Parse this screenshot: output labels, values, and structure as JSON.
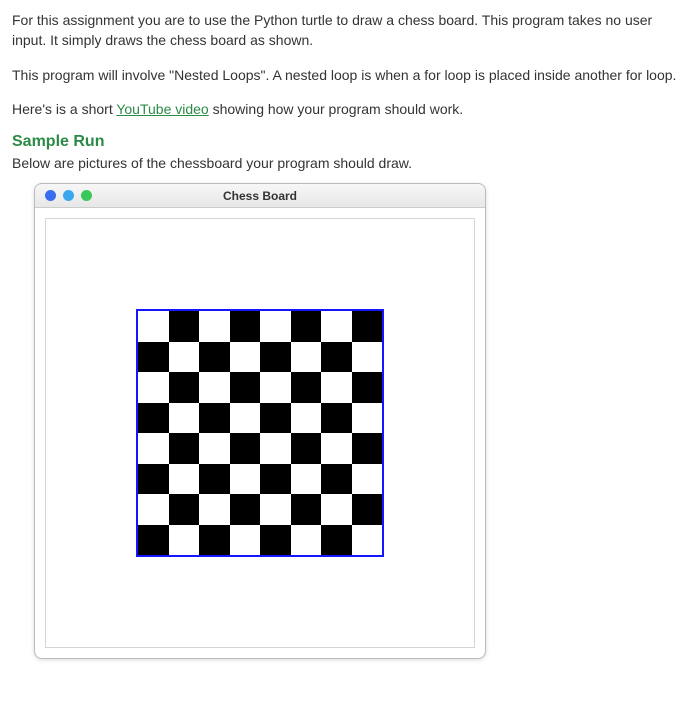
{
  "para1": "For this assignment you are to use the Python turtle to draw a chess board. This program takes no user input. It simply draws the chess board as shown.",
  "para2": "This program will involve \"Nested Loops\". A nested loop is when a for loop is placed inside another for loop.",
  "para3_prefix": "Here's is a short ",
  "para3_link": "YouTube video",
  "para3_suffix": " showing how your program should work.",
  "sample_heading": "Sample Run",
  "sample_sub": "Below are pictures of the chessboard your program should draw.",
  "window_title": "Chess Board",
  "board": {
    "rows": 8,
    "cols": 8,
    "border_color": "#1515ff"
  }
}
